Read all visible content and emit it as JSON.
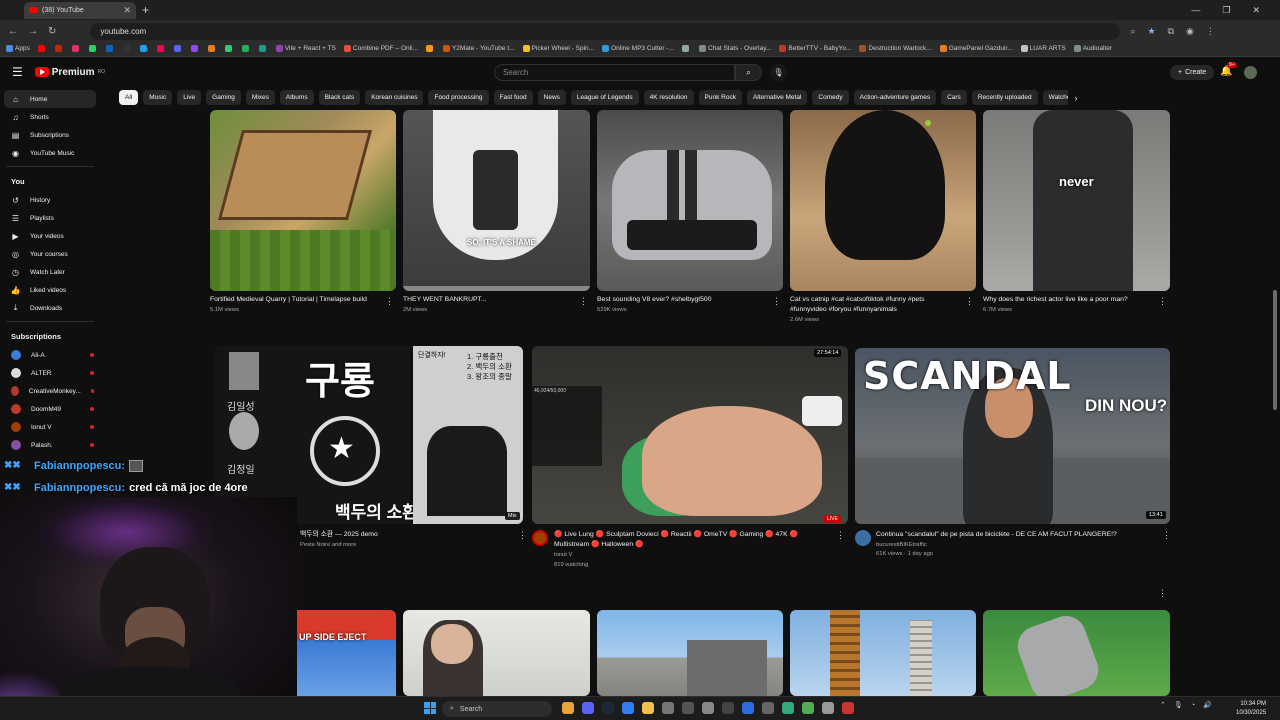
{
  "browser": {
    "tab_title": "(38) YouTube",
    "url": "youtube.com",
    "bookmarks": [
      {
        "label": "Apps",
        "color": "#4f8de0"
      },
      {
        "label": "",
        "color": "#ff0000"
      },
      {
        "label": "",
        "color": "#cc2200"
      },
      {
        "label": "",
        "color": "#e03070"
      },
      {
        "label": "",
        "color": "#25d366"
      },
      {
        "label": "",
        "color": "#0a66c2"
      },
      {
        "label": "",
        "color": "#333333"
      },
      {
        "label": "",
        "color": "#1da1f2"
      },
      {
        "label": "",
        "color": "#ff0050"
      },
      {
        "label": "",
        "color": "#5865f2"
      },
      {
        "label": "",
        "color": "#9146ff"
      },
      {
        "label": "",
        "color": "#e67e22"
      },
      {
        "label": "",
        "color": "#2ecc71"
      },
      {
        "label": "",
        "color": "#27ae60"
      },
      {
        "label": "",
        "color": "#16a085"
      },
      {
        "label": "Vite + React + TS",
        "color": "#8e44ad"
      },
      {
        "label": "Combine PDF – Onli...",
        "color": "#e74c3c"
      },
      {
        "label": "",
        "color": "#f39c12"
      },
      {
        "label": "Y2Mate - YouTube t...",
        "color": "#d35400"
      },
      {
        "label": "Picker Wheel - Spin...",
        "color": "#f1c40f"
      },
      {
        "label": "Online MP3 Cutter -...",
        "color": "#3498db"
      },
      {
        "label": "",
        "color": "#95a5a6"
      },
      {
        "label": "Chat Stats - Overlay...",
        "color": "#7f8c8d"
      },
      {
        "label": "BetterTTV - BabyYo...",
        "color": "#c0392b"
      },
      {
        "label": "Destruction Warlock...",
        "color": "#a0522d"
      },
      {
        "label": "GamePanel Gazduir...",
        "color": "#e67e22"
      },
      {
        "label": "LUAR ARTS",
        "color": "#bdc3c7"
      },
      {
        "label": "Audioalter",
        "color": "#7f8c8d"
      }
    ]
  },
  "header": {
    "logo_text": "Premium",
    "logo_sup": "RO",
    "search_placeholder": "Search",
    "create_label": "Create",
    "notif_count": "9+"
  },
  "chips": [
    "All",
    "Music",
    "Live",
    "Gaming",
    "Mixes",
    "Albums",
    "Black cats",
    "Korean cuisines",
    "Food processing",
    "Fast food",
    "News",
    "League of Legends",
    "4K resolution",
    "Punk Rock",
    "Alternative Metal",
    "Comedy",
    "Action-adventure games",
    "Cars",
    "Recently uploaded",
    "Watched",
    "New"
  ],
  "sidebar": {
    "main": [
      {
        "label": "Home",
        "icon": "home-icon",
        "glyph": "⌂"
      },
      {
        "label": "Shorts",
        "icon": "shorts-icon",
        "glyph": "♫"
      },
      {
        "label": "Subscriptions",
        "icon": "subscriptions-icon",
        "glyph": "▤"
      },
      {
        "label": "YouTube Music",
        "icon": "music-icon",
        "glyph": "◉"
      }
    ],
    "you_heading": "You",
    "you": [
      {
        "label": "History",
        "icon": "history-icon",
        "glyph": "↺"
      },
      {
        "label": "Playlists",
        "icon": "playlists-icon",
        "glyph": "☰"
      },
      {
        "label": "Your videos",
        "icon": "your-videos-icon",
        "glyph": "▶"
      },
      {
        "label": "Your courses",
        "icon": "courses-icon",
        "glyph": "◎"
      },
      {
        "label": "Watch Later",
        "icon": "watch-later-icon",
        "glyph": "◷"
      },
      {
        "label": "Liked videos",
        "icon": "like-icon",
        "glyph": "👍"
      },
      {
        "label": "Downloads",
        "icon": "download-icon",
        "glyph": "⤓"
      }
    ],
    "subs_heading": "Subscriptions",
    "subscriptions": [
      {
        "label": "Ali-A",
        "color": "#3a7bd5"
      },
      {
        "label": "ALTER",
        "color": "#dddddd"
      },
      {
        "label": "CreativeMonkey...",
        "color": "#b03a2e"
      },
      {
        "label": "DoomM49",
        "color": "#c0392b"
      },
      {
        "label": "Ionut V",
        "color": "#a04000"
      },
      {
        "label": "Palash.",
        "color": "#884ea0"
      }
    ]
  },
  "videos_row1": [
    {
      "title": "Fortified Medieval Quarry | Tutorial | Timelapse build",
      "meta": "5.1M views"
    },
    {
      "title": "THEY WENT BANKRUPT...",
      "meta": "2M views",
      "overlay": "SO, IT'S A SHAME"
    },
    {
      "title": "Best sounding V8 ever? #shelbygt500",
      "meta": "529K views"
    },
    {
      "title": "Cat vs catnip #cat #catsoftiktok #funny #pets #funnyvideo #foryou #funnyanimals",
      "meta": "2.6M views"
    },
    {
      "title": "Why does the richest actor live like a poor man?",
      "meta": "6.7M views",
      "overlay": "never"
    }
  ],
  "videos_row2": [
    {
      "title": "백두의 소환 — 2025 demo",
      "meta": "Peste Noire and more",
      "badge": "Mix",
      "poster_big": "구룡",
      "poster_side": "백두의 소환",
      "poster_list": "1. 구룡출천\n2. 백두의 소환\n3. 왕조의 종말",
      "poster_top": "단결하자!",
      "poster_names1": "김일성",
      "poster_names2": "김정일"
    },
    {
      "title": "🔴 Live Lung 🔴 Sculptam Dovieci 🔴 Reactii 🔴 OmeTV 🔴 Gaming 🔴 47K 🔴 Multistream 🔴 Halloween 🔴",
      "channel": "Ionut V",
      "meta": "819 watching",
      "duration": "27:54:14",
      "live": "LIVE",
      "count_text": "46,924/50,000"
    },
    {
      "title": "Continua \"scandalul\" de pe pista de biciclete - DE CE AM FACUT PLANGERE!?",
      "channel": "bucurestiBIKEtraffic",
      "meta": "61K views · 1 day ago",
      "duration": "13:41",
      "overlay": "SCANDAL",
      "overlay2": "DIN NOU?"
    }
  ],
  "videos_row3": [
    {
      "overlay": "UP SIDE EJECT"
    },
    {},
    {},
    {},
    {}
  ],
  "chat": [
    {
      "name": "Fabiannpopescu:",
      "msg": ""
    },
    {
      "name": "Fabiannpopescu:",
      "msg": "cred că mă joc de 4ore"
    }
  ],
  "taskbar": {
    "search": "Search",
    "time": "10:34 PM",
    "date": "10/30/2025"
  }
}
